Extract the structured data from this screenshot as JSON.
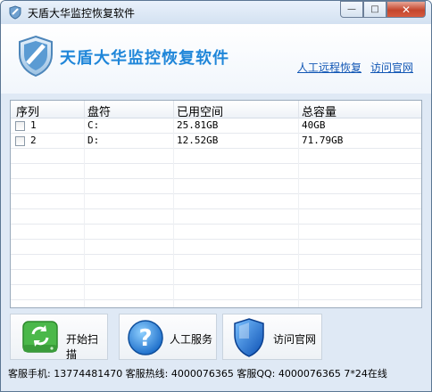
{
  "window": {
    "title": "天盾大华监控恢复软件",
    "minimize_glyph": "—",
    "maximize_glyph": "□",
    "close_glyph": "✕"
  },
  "header": {
    "app_title": "天盾大华监控恢复软件",
    "link_remote": "人工远程恢复",
    "link_site": "访问官网"
  },
  "table": {
    "columns": [
      "序列",
      "盘符",
      "已用空间",
      "总容量"
    ],
    "rows": [
      {
        "index": "1",
        "drive": "C:",
        "used": "25.81GB",
        "total": "40GB",
        "checked": false
      },
      {
        "index": "2",
        "drive": "D:",
        "used": "12.52GB",
        "total": "71.79GB",
        "checked": false
      }
    ]
  },
  "actions": {
    "scan_label": "开始扫描",
    "service_label": "人工服务",
    "site_label": "访问官网"
  },
  "status": {
    "text": "客服手机: 13774481470 客服热线: 4000076365 客服QQ: 4000076365 7*24在线"
  },
  "icons": {
    "title": "shield-icon",
    "header": "shield-logo-icon",
    "scan": "refresh-drive-icon",
    "service": "question-icon",
    "site": "shield-icon"
  },
  "colors": {
    "accent": "#1f86d9",
    "link": "#1257b5",
    "window_bg": "#dfe9f5"
  }
}
